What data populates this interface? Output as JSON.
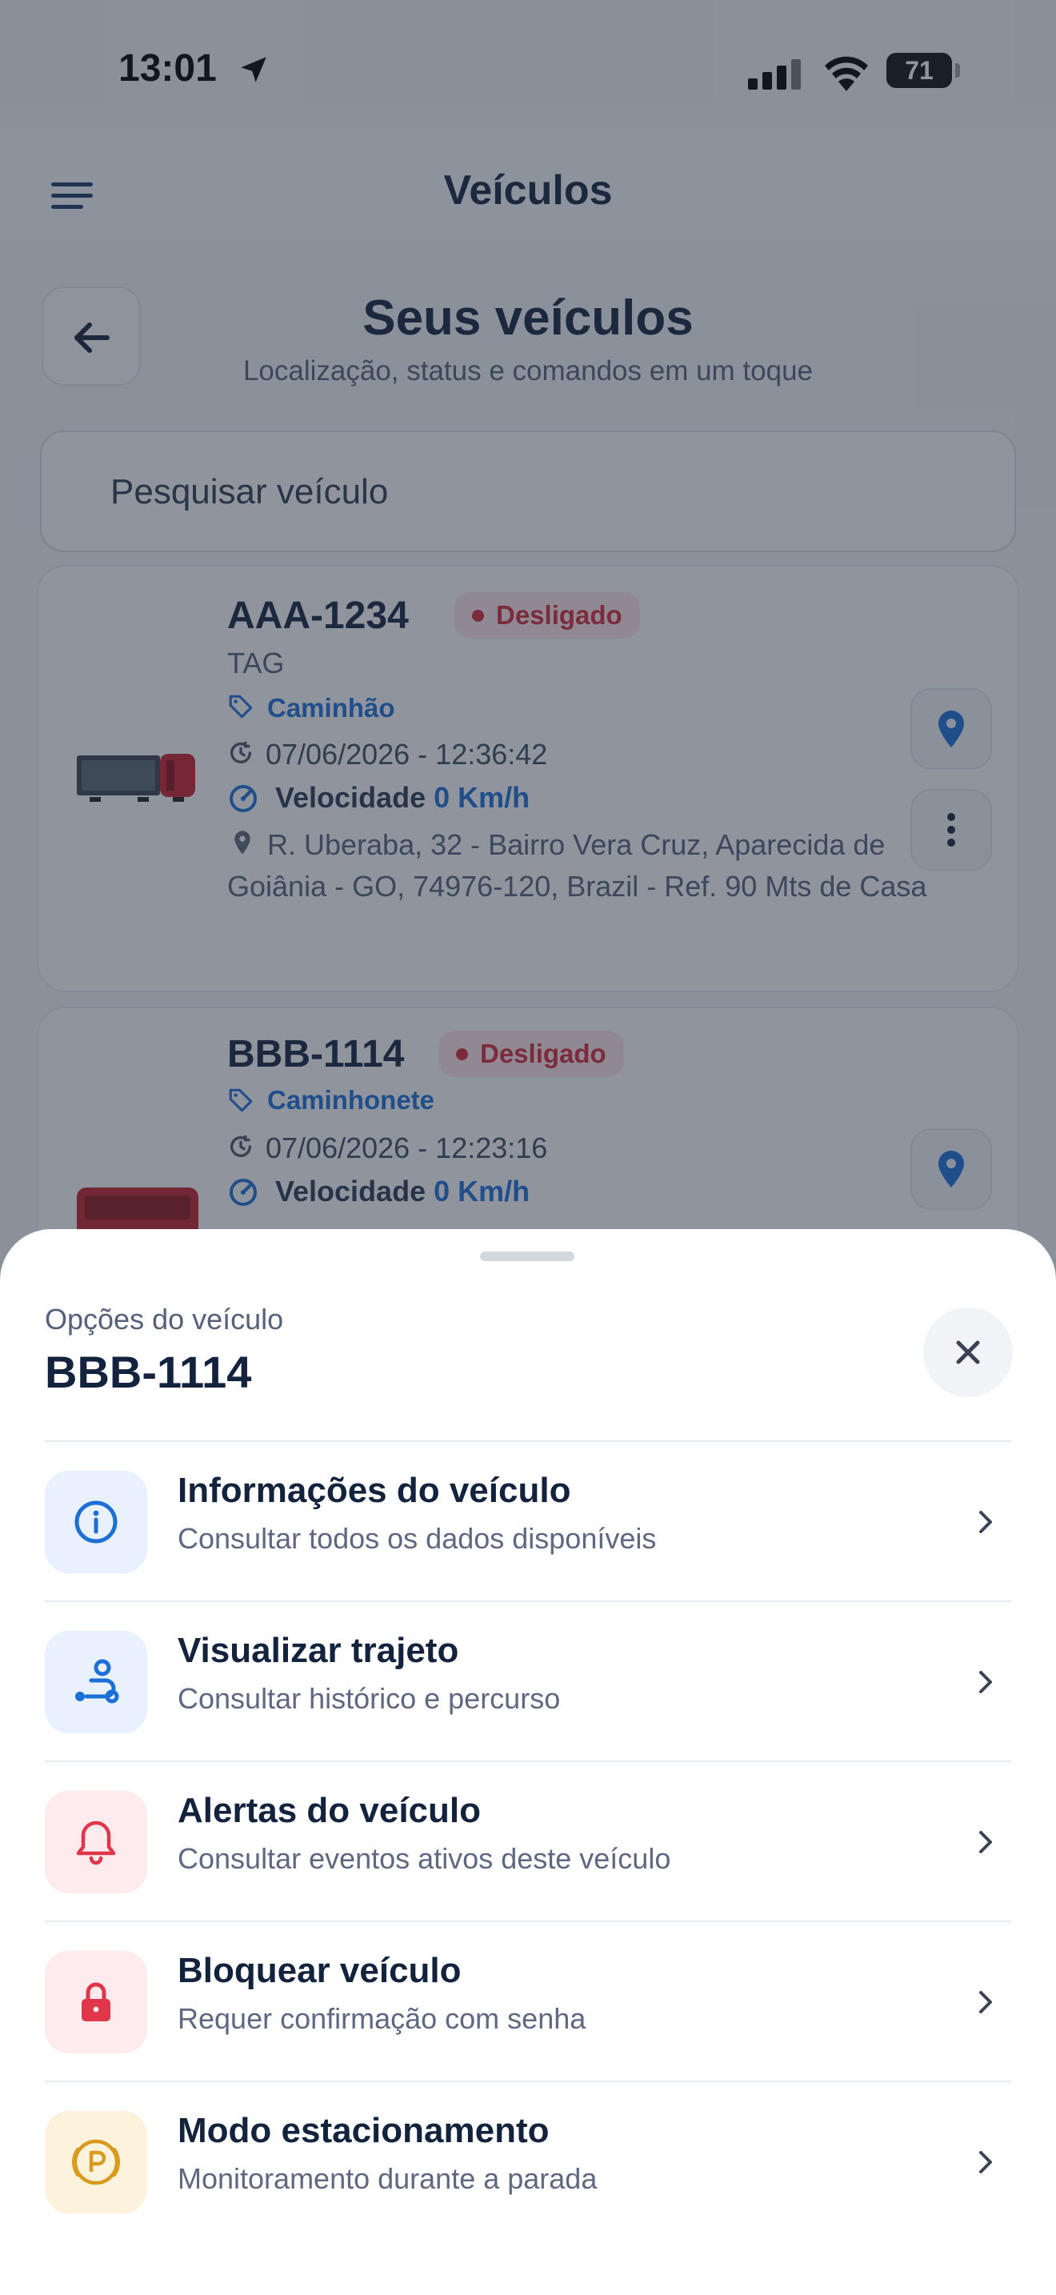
{
  "status_bar": {
    "time": "13:01",
    "battery": "71"
  },
  "app_bar": {
    "title": "Veículos",
    "menu_icon": "hamburger-menu-icon"
  },
  "header": {
    "title": "Seus veículos",
    "subtitle": "Localização, status e comandos em um toque",
    "back_icon": "arrow-left-icon"
  },
  "search": {
    "placeholder": "Pesquisar veículo"
  },
  "vehicles": [
    {
      "plate": "AAA-1234",
      "status": "Desligado",
      "tag": "TAG",
      "category": "Caminhão",
      "datetime": "07/06/2026 - 12:36:42",
      "speed_label": "Velocidade",
      "speed_value": "0 Km/h",
      "address": "R. Uberaba, 32 - Bairro Vera Cruz, Aparecida de Goiânia - GO, 74976-120, Brazil - Ref. 90 Mts de Casa"
    },
    {
      "plate": "BBB-1114",
      "status": "Desligado",
      "category": "Caminhonete",
      "datetime": "07/06/2026 - 12:23:16",
      "speed_label": "Velocidade",
      "speed_value": "0 Km/h"
    }
  ],
  "sheet": {
    "eyebrow": "Opções do veículo",
    "title": "BBB-1114",
    "close_icon": "close-icon",
    "options": [
      {
        "title": "Informações do veículo",
        "subtitle": "Consultar todos os dados disponíveis",
        "icon": "info-icon",
        "icon_bg": "#e8f1fd",
        "icon_color": "#1c6fd6"
      },
      {
        "title": "Visualizar trajeto",
        "subtitle": "Consultar histórico e percurso",
        "icon": "route-icon",
        "icon_bg": "#e8f1fd",
        "icon_color": "#1c6fd6"
      },
      {
        "title": "Alertas do veículo",
        "subtitle": "Consultar eventos ativos deste veículo",
        "icon": "bell-icon",
        "icon_bg": "#fdebee",
        "icon_color": "#e0364a"
      },
      {
        "title": "Bloquear veículo",
        "subtitle": "Requer confirmação com senha",
        "icon": "lock-icon",
        "icon_bg": "#fdebee",
        "icon_color": "#e0364a"
      },
      {
        "title": "Modo estacionamento",
        "subtitle": "Monitoramento durante a parada",
        "icon": "parking-icon",
        "icon_bg": "#fdf3dc",
        "icon_color": "#d89b1e"
      }
    ]
  },
  "colors": {
    "accent": "#1c6fd6",
    "danger": "#d1283a",
    "overlay": "rgba(35,45,62,0.5)"
  }
}
